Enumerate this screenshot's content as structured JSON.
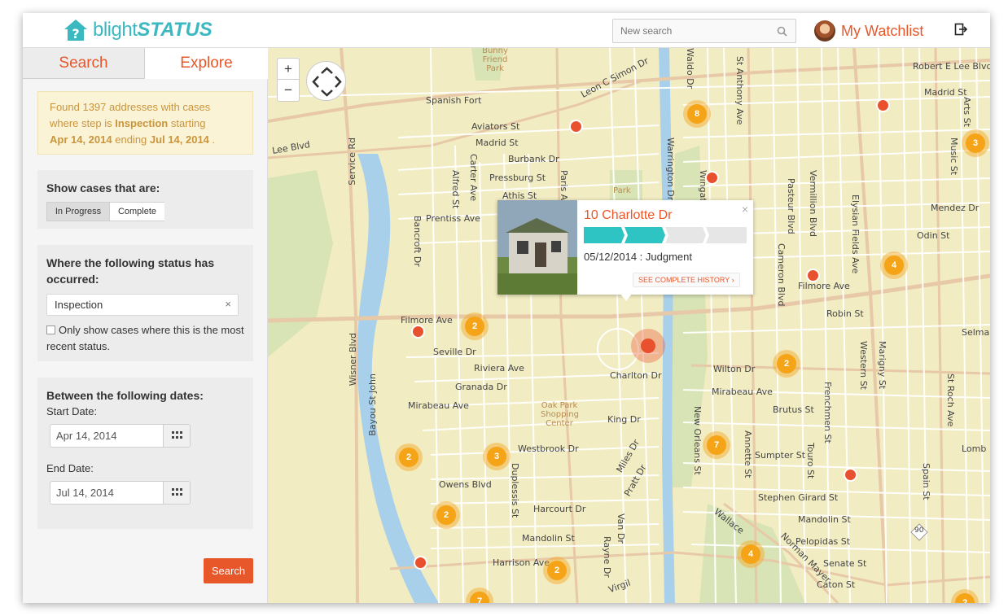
{
  "header": {
    "logo_part1": "blight",
    "logo_part2": "STATUS",
    "search_placeholder": "New search",
    "watchlist_label": "My Watchlist"
  },
  "sidebar": {
    "tabs": [
      {
        "label": "Search"
      },
      {
        "label": "Explore"
      }
    ],
    "summary": {
      "prefix": "Found 1397 addresses with cases where step is",
      "step": "Inspection",
      "starting": "starting",
      "start": "Apr 14, 2014",
      "ending": "ending",
      "end": "Jul 14, 2014",
      "period": "."
    },
    "show_cases": {
      "title": "Show cases that are:",
      "options": [
        "In Progress",
        "Complete"
      ],
      "selected": "In Progress"
    },
    "status_filter": {
      "title": "Where the following status has occurred:",
      "value": "Inspection",
      "checkbox_label": "Only show cases where this is the most recent status."
    },
    "dates": {
      "title": "Between the following dates:",
      "start_label": "Start Date:",
      "start_value": "Apr 14, 2014",
      "end_label": "End Date:",
      "end_value": "Jul 14, 2014"
    },
    "search_button": "Search"
  },
  "map": {
    "zoom_in": "+",
    "zoom_out": "−",
    "clusters": [
      "8",
      "3",
      "4",
      "2",
      "2",
      "2",
      "3",
      "7",
      "2",
      "2",
      "4",
      "7",
      "2"
    ],
    "popup": {
      "address": "10 Charlotte Dr",
      "close": "×",
      "event": "05/12/2014 : Judgment",
      "history_label": "SEE COMPLETE HISTORY",
      "progress_steps_complete": 2,
      "progress_steps_total": 4
    },
    "labels": {
      "spanish_fort": "Spanish Fort",
      "aviators": "Aviators St",
      "madrid": "Madrid St",
      "burbank": "Burbank Dr",
      "pressburg": "Pressburg St",
      "athis": "Athis St",
      "prentiss": "Prentiss Ave",
      "filmore_w": "Filmore Ave",
      "seville": "Seville Dr",
      "riviera": "Riviera Ave",
      "granada": "Granada Dr",
      "mirabeau_w": "Mirabeau Ave",
      "westbrook": "Westbrook Dr",
      "owens": "Owens Blvd",
      "harcourt": "Harcourt Dr",
      "mandolin_w": "Mandolin St",
      "harrison": "Harrison Ave",
      "charlton": "Charlton Dr",
      "king": "King Dr",
      "oak_park": "Oak Park Shopping Center",
      "wilton": "Wilton Dr",
      "mirabeau_e": "Mirabeau Ave",
      "brutus": "Brutus St",
      "sumpter": "Sumpter St",
      "stephen_girard": "Stephen Girard St",
      "mandolin_e": "Mandolin St",
      "pelopidas": "Pelopidas St",
      "senate": "Senate St",
      "caton": "Caton St",
      "filmore_e": "Filmore Ave",
      "robin": "Robin St",
      "odin": "Odin St",
      "mendez": "Mendez Dr",
      "madrid_e": "Madrid St",
      "robert_e_lee": "Robert E Lee Blvd",
      "selma": "Selma",
      "lombard": "Lomb",
      "leon_simon": "Leon C Simon Dr",
      "lee_blvd": "Lee Blvd",
      "bancroft": "Bancroft Dr",
      "wisner": "Wisner Blvd",
      "bayou": "Bayou St John",
      "service": "Service Rd",
      "paris_ave": "Paris Ave",
      "st_anthony": "St Anthony Ave",
      "elysian": "Elysian Fields Ave",
      "pasteur": "Pasteur Blvd",
      "vermillion": "Vermillion Blvd",
      "new_orleans": "New Orleans St",
      "annette": "Annette St",
      "touro": "Touro St",
      "frenchmen": "Frenchmen St",
      "marigny": "Marigny St",
      "western": "Western St",
      "music": "Music St",
      "st_roch": "St Roch Ave",
      "spain": "Spain St",
      "arts": "Arts St",
      "waldo": "Waldo Dr",
      "warrington": "Warrington Dr",
      "wingate": "Wingate",
      "cameron": "Cameron Blvd",
      "wallace": "Wallace",
      "norman_mayer": "Norman Mayer",
      "carter": "Carter Ave",
      "alfred": "Alfred St",
      "duplessis": "Duplessis St",
      "miles": "Miles Dr",
      "pratt": "Pratt Dr",
      "van": "Van Dr",
      "rayne": "Rayne Dr",
      "virgil": "Virgil",
      "park": "Park",
      "bunny": "Bunny Friend Park",
      "hwy90": "90"
    }
  }
}
